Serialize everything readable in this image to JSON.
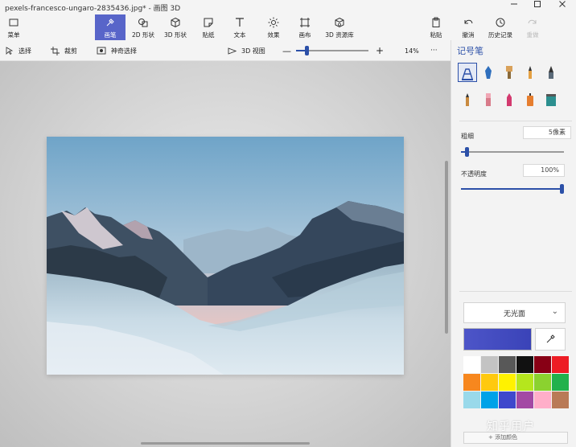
{
  "window": {
    "title": "pexels-francesco-ungaro-2835436.jpg* - 画图 3D"
  },
  "ribbon": {
    "menu_label": "菜单",
    "tools": [
      {
        "id": "brushes",
        "label": "画笔",
        "icon": "brush-icon",
        "active": true
      },
      {
        "id": "2d-shapes",
        "label": "2D 形状",
        "icon": "2d-shapes-icon"
      },
      {
        "id": "3d-shapes",
        "label": "3D 形状",
        "icon": "cube-icon"
      },
      {
        "id": "stickers",
        "label": "贴纸",
        "icon": "sticker-icon"
      },
      {
        "id": "text",
        "label": "文本",
        "icon": "text-icon"
      },
      {
        "id": "effects",
        "label": "效果",
        "icon": "sun-icon"
      },
      {
        "id": "canvas",
        "label": "画布",
        "icon": "canvas-icon"
      },
      {
        "id": "3d-library",
        "label": "3D 资源库",
        "icon": "3d-library-icon"
      }
    ],
    "right_tools": [
      {
        "id": "paste",
        "label": "粘贴",
        "icon": "paste-icon"
      },
      {
        "id": "undo",
        "label": "撤消",
        "icon": "undo-icon"
      },
      {
        "id": "history",
        "label": "历史记录",
        "icon": "history-icon"
      },
      {
        "id": "redo",
        "label": "重做",
        "icon": "redo-icon",
        "disabled": true
      }
    ]
  },
  "toolbar": {
    "select_label": "选择",
    "crop_label": "裁剪",
    "magic_select_label": "神奇选择",
    "view3d_label": "3D 视图",
    "zoom_minus": "—",
    "zoom_plus": "+",
    "zoom_value": "14%",
    "zoom_level": 0.13,
    "more_label": "···"
  },
  "panel": {
    "title": "记号笔",
    "thickness_label": "粗细",
    "thickness_value": "5像素",
    "thickness_level": 0.04,
    "opacity_label": "不透明度",
    "opacity_value": "100%",
    "opacity_level": 1.0,
    "finish_label": "无光面",
    "current_color": "#4d55c8",
    "brushes": [
      {
        "name": "marker-icon",
        "color": "#2c50a8",
        "selected": true
      },
      {
        "name": "calligraphy-pen-icon",
        "color": "#2f6fbd"
      },
      {
        "name": "oil-brush-icon",
        "color": "#d9a15a"
      },
      {
        "name": "watercolor-icon",
        "color": "#e4a042"
      },
      {
        "name": "pixel-pen-icon",
        "color": "#5a6a78"
      },
      {
        "name": "pencil-icon",
        "color": "#c98a3f"
      },
      {
        "name": "eraser-icon",
        "color": "#d87b8a"
      },
      {
        "name": "crayon-icon",
        "color": "#d33a6f"
      },
      {
        "name": "spray-can-icon",
        "color": "#e67e2f"
      },
      {
        "name": "fill-bucket-icon",
        "color": "#2c8f8f"
      }
    ],
    "swatches": [
      "#ffffff",
      "#c3c3c3",
      "#585858",
      "#111111",
      "#880015",
      "#ed1c24",
      "#f7871e",
      "#ffc90e",
      "#fff200",
      "#b5e61d",
      "#8bd22f",
      "#22b14c",
      "#99d9ea",
      "#00a2e8",
      "#3f48cc",
      "#a349a4",
      "#ffaec9",
      "#b97a57"
    ],
    "add_color_label": "+ 添加颜色"
  },
  "watermark": "知乎用户"
}
